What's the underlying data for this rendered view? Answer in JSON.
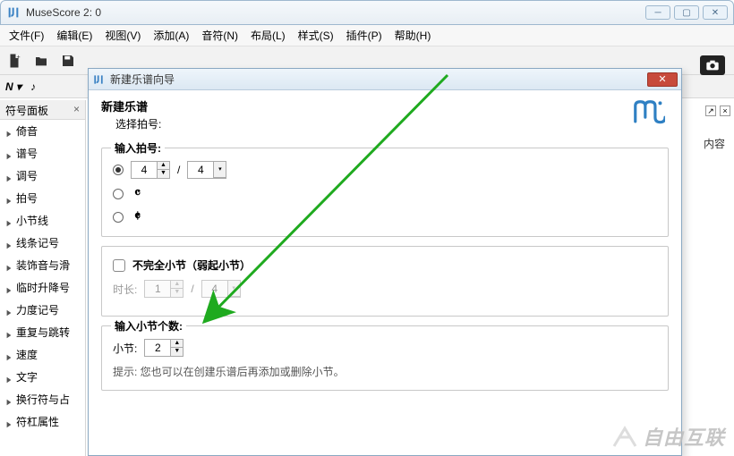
{
  "window": {
    "title": "MuseScore 2: 0"
  },
  "menu": {
    "file": "文件(F)",
    "edit": "编辑(E)",
    "view": "视图(V)",
    "add": "添加(A)",
    "note": "音符(N)",
    "layout": "布局(L)",
    "style": "样式(S)",
    "plugin": "插件(P)",
    "help": "帮助(H)"
  },
  "sidepanel": {
    "title": "符号面板",
    "items": [
      "倚音",
      "谱号",
      "调号",
      "拍号",
      "小节线",
      "线条记号",
      "装饰音与滑",
      "临时升降号",
      "力度记号",
      "重复与跳转",
      "速度",
      "文字",
      "换行符与占",
      "符杠属性"
    ]
  },
  "right_panel": {
    "label": "内容"
  },
  "dialog": {
    "title": "新建乐谱向导",
    "head_title": "新建乐谱",
    "head_sub": "选择拍号:",
    "group_timesig": {
      "title": "输入拍号:",
      "numerator": "4",
      "denominator": "4",
      "slash": "/"
    },
    "group_pickup": {
      "checkbox_label": "不完全小节（弱起小节）",
      "duration_label": "时长:",
      "duration_num": "1",
      "duration_den": "4",
      "slash": "/"
    },
    "group_measures": {
      "title": "输入小节个数:",
      "measure_label": "小节:",
      "measure_value": "2",
      "hint_prefix": "提示: ",
      "hint_text": "您也可以在创建乐谱后再添加或删除小节。"
    },
    "glyphs": {
      "common": "𝄴",
      "cut": "𝄵"
    }
  },
  "watermark": "自由互联"
}
